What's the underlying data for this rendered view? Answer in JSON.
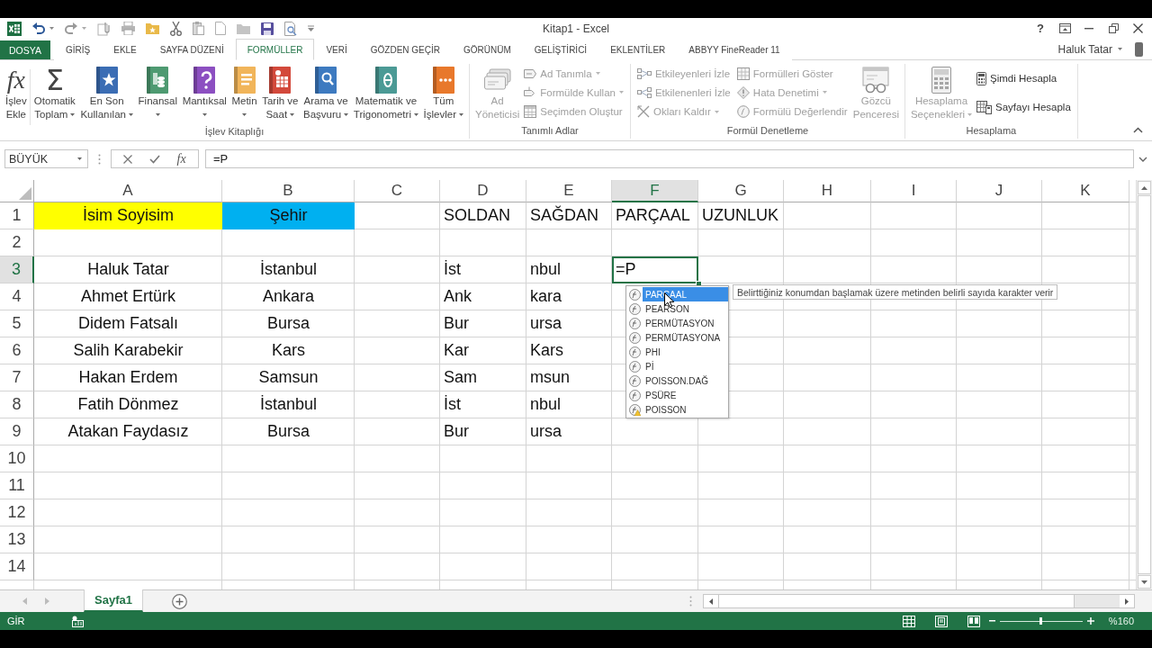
{
  "window": {
    "title": "Kitap1 - Excel",
    "help": "?",
    "user": "Haluk Tatar"
  },
  "ribbon_tabs": [
    {
      "label": "DOSYA",
      "kind": "file",
      "selected": false
    },
    {
      "label": "GİRİŞ",
      "kind": "tab",
      "selected": false
    },
    {
      "label": "EKLE",
      "kind": "tab",
      "selected": false
    },
    {
      "label": "SAYFA DÜZENİ",
      "kind": "tab",
      "selected": false
    },
    {
      "label": "FORMÜLLER",
      "kind": "tab",
      "selected": true
    },
    {
      "label": "VERİ",
      "kind": "tab",
      "selected": false
    },
    {
      "label": "GÖZDEN GEÇİR",
      "kind": "tab",
      "selected": false
    },
    {
      "label": "GÖRÜNÜM",
      "kind": "tab",
      "selected": false
    },
    {
      "label": "GELİŞTİRİCİ",
      "kind": "tab",
      "selected": false
    },
    {
      "label": "EKLENTİLER",
      "kind": "tab",
      "selected": false
    },
    {
      "label": "ABBYY FineReader 11",
      "kind": "tab",
      "selected": false
    }
  ],
  "ribbon_groups": [
    {
      "label": "İşlev Kitaplığı",
      "items": [
        {
          "kind": "large",
          "symbol": "fx",
          "lines": [
            "İşlev",
            "Ekle"
          ],
          "dropdown": false,
          "disabled": false
        },
        {
          "kind": "large",
          "symbol": "Σ",
          "lines": [
            "Otomatik",
            "Toplam"
          ],
          "dropdown": true,
          "disabled": false
        },
        {
          "kind": "large",
          "lines": [
            "En Son",
            "Kullanılan"
          ],
          "dropdown": true,
          "disabled": false
        },
        {
          "kind": "large",
          "lines": [
            "Finansal"
          ],
          "dropdown": true,
          "disabled": false
        },
        {
          "kind": "large",
          "lines": [
            "Mantıksal"
          ],
          "dropdown": true,
          "disabled": false
        },
        {
          "kind": "large",
          "lines": [
            "Metin"
          ],
          "dropdown": true,
          "disabled": false
        },
        {
          "kind": "large",
          "lines": [
            "Tarih ve",
            "Saat"
          ],
          "dropdown": true,
          "disabled": false
        },
        {
          "kind": "large",
          "lines": [
            "Arama ve",
            "Başvuru"
          ],
          "dropdown": true,
          "disabled": false
        },
        {
          "kind": "large",
          "lines": [
            "Matematik ve",
            "Trigonometri"
          ],
          "dropdown": true,
          "disabled": false
        },
        {
          "kind": "large",
          "lines": [
            "Tüm",
            "İşlevler"
          ],
          "dropdown": true,
          "disabled": false
        }
      ]
    },
    {
      "label": "Tanımlı Adlar",
      "items": [
        {
          "kind": "large",
          "lines": [
            "Ad",
            "Yöneticisi"
          ],
          "dropdown": false,
          "disabled": true
        },
        {
          "kind": "stack",
          "items": [
            {
              "label": "Ad Tanımla",
              "dropdown": true,
              "disabled": true
            },
            {
              "label": "Formülde Kullan",
              "dropdown": true,
              "disabled": true
            },
            {
              "label": "Seçimden Oluştur",
              "dropdown": false,
              "disabled": true
            }
          ]
        }
      ]
    },
    {
      "label": "Formül Denetleme",
      "items": [
        {
          "kind": "stack",
          "items": [
            {
              "label": "Etkileyenleri İzle",
              "dropdown": false,
              "disabled": true
            },
            {
              "label": "Etkilenenleri İzle",
              "dropdown": false,
              "disabled": true
            },
            {
              "label": "Okları Kaldır",
              "dropdown": true,
              "disabled": true
            }
          ]
        },
        {
          "kind": "stack",
          "items": [
            {
              "label": "Formülleri Göster",
              "dropdown": false,
              "disabled": true
            },
            {
              "label": "Hata Denetimi",
              "dropdown": true,
              "disabled": true
            },
            {
              "label": "Formülü Değerlendir",
              "dropdown": false,
              "disabled": true
            }
          ]
        },
        {
          "kind": "large",
          "lines": [
            "Gözcü",
            "Penceresi"
          ],
          "dropdown": false,
          "disabled": true
        }
      ]
    },
    {
      "label": "Hesaplama",
      "items": [
        {
          "kind": "large",
          "lines": [
            "Hesaplama",
            "Seçenekleri"
          ],
          "dropdown": true,
          "disabled": true
        },
        {
          "kind": "stack",
          "items": [
            {
              "label": "Şimdi Hesapla",
              "dropdown": false,
              "disabled": false
            },
            {
              "label": "Sayfayı Hesapla",
              "dropdown": false,
              "disabled": false
            }
          ]
        }
      ]
    }
  ],
  "formula_bar": {
    "name_box": "BÜYÜK",
    "symbol": "fx",
    "formula": "=P"
  },
  "sheet": {
    "columns": [
      {
        "label": "A",
        "selected": false
      },
      {
        "label": "B",
        "selected": false
      },
      {
        "label": "C",
        "selected": false
      },
      {
        "label": "D",
        "selected": false
      },
      {
        "label": "E",
        "selected": false
      },
      {
        "label": "F",
        "selected": true
      },
      {
        "label": "G",
        "selected": false
      },
      {
        "label": "H",
        "selected": false
      },
      {
        "label": "I",
        "selected": false
      },
      {
        "label": "J",
        "selected": false
      },
      {
        "label": "K",
        "selected": false
      }
    ],
    "rows": [
      {
        "label": "1",
        "selected": false,
        "cells": [
          {
            "text": "İsim Soyisim",
            "color": "#ffff00"
          },
          {
            "text": "Şehir",
            "color": "#00b0f0"
          },
          null,
          {
            "text": "SOLDAN"
          },
          {
            "text": "SAĞDAN"
          },
          {
            "text": "PARÇAAL"
          },
          {
            "text": "UZUNLUK"
          }
        ]
      },
      {
        "label": "2",
        "selected": false
      },
      {
        "label": "3",
        "selected": true,
        "cells": [
          {
            "text": "Haluk Tatar"
          },
          {
            "text": "İstanbul"
          },
          null,
          {
            "text": "İst"
          },
          {
            "text": "nbul"
          },
          {
            "text": "=P"
          }
        ]
      },
      {
        "label": "4",
        "selected": false,
        "cells": [
          {
            "text": "Ahmet Ertürk"
          },
          {
            "text": "Ankara"
          },
          null,
          {
            "text": "Ank"
          },
          {
            "text": "kara"
          }
        ]
      },
      {
        "label": "5",
        "selected": false,
        "cells": [
          {
            "text": "Didem Fatsalı"
          },
          {
            "text": "Bursa"
          },
          null,
          {
            "text": "Bur"
          },
          {
            "text": "ursa"
          }
        ]
      },
      {
        "label": "6",
        "selected": false,
        "cells": [
          {
            "text": "Salih Karabekir"
          },
          {
            "text": "Kars"
          },
          null,
          {
            "text": "Kar"
          },
          {
            "text": "Kars"
          }
        ]
      },
      {
        "label": "7",
        "selected": false,
        "cells": [
          {
            "text": "Hakan Erdem"
          },
          {
            "text": "Samsun"
          },
          null,
          {
            "text": "Sam"
          },
          {
            "text": "msun"
          }
        ]
      },
      {
        "label": "8",
        "selected": false,
        "cells": [
          {
            "text": "Fatih Dönmez"
          },
          {
            "text": "İstanbul"
          },
          null,
          {
            "text": "İst"
          },
          {
            "text": "nbul"
          }
        ]
      },
      {
        "label": "9",
        "selected": false,
        "cells": [
          {
            "text": "Atakan Faydasız"
          },
          {
            "text": "Bursa"
          },
          null,
          {
            "text": "Bur"
          },
          {
            "text": "ursa"
          }
        ]
      },
      {
        "label": "10",
        "selected": false
      },
      {
        "label": "11",
        "selected": false
      },
      {
        "label": "12",
        "selected": false
      },
      {
        "label": "13",
        "selected": false
      },
      {
        "label": "14",
        "selected": false
      }
    ]
  },
  "autocomplete": {
    "items": [
      {
        "label": "PARÇAAL",
        "kind": "function",
        "selected": true
      },
      {
        "label": "PEARSON",
        "kind": "function",
        "selected": false
      },
      {
        "label": "PERMÜTASYON",
        "kind": "function",
        "selected": false
      },
      {
        "label": "PERMÜTASYONA",
        "kind": "function",
        "selected": false
      },
      {
        "label": "PHI",
        "kind": "function",
        "selected": false
      },
      {
        "label": "Pİ",
        "kind": "function",
        "selected": false
      },
      {
        "label": "POISSON.DAĞ",
        "kind": "function",
        "selected": false
      },
      {
        "label": "PSÜRE",
        "kind": "function",
        "selected": false
      },
      {
        "label": "POISSON",
        "kind": "compatibility",
        "selected": false
      }
    ],
    "tooltip": "Belirttiğiniz konumdan başlamak üzere metinden belirli sayıda karakter verir"
  },
  "sheet_tabs": [
    {
      "label": "Sayfa1",
      "selected": true
    }
  ],
  "status_bar": {
    "mode": "GİR",
    "zoom_slider": {
      "level": 0.5
    },
    "zoom": "%160"
  }
}
